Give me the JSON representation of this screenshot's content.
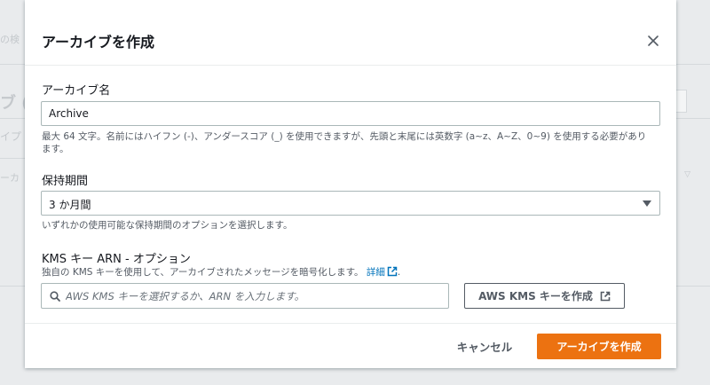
{
  "modal": {
    "title": "アーカイブを作成",
    "close_icon": "close-icon"
  },
  "archive_name": {
    "label": "アーカイブ名",
    "value": "Archive",
    "description_line1": "最大 64 文字。名前にはハイフン (-)、アンダースコア (_) を使用できますが、先頭と末尾には英数字 (a~z、A~Z、0~9) を使用する必要があり",
    "description_line2": "ます。"
  },
  "retention": {
    "label": "保持期間",
    "selected": "3 か月間",
    "description": "いずれかの使用可能な保持期間のオプションを選択します。"
  },
  "kms": {
    "label": "KMS キー ARN - オプション",
    "description": "独自の KMS キーを使用して、アーカイブされたメッセージを暗号化します。",
    "details_link": "詳細",
    "description_end": ".",
    "search_placeholder": "AWS KMS キーを選択するか、ARN を入力します。",
    "create_key_button": "AWS KMS キーを作成"
  },
  "footer": {
    "cancel_label": "キャンセル",
    "create_label": "アーカイブを作成"
  },
  "background": {
    "frag1": "の検",
    "frag2": "ブ (",
    "frag3": "イプ",
    "frag4": "ーカ"
  },
  "colors": {
    "primary": "#ec7211",
    "link": "#0073bb",
    "text": "#16191f",
    "muted": "#545b64"
  }
}
